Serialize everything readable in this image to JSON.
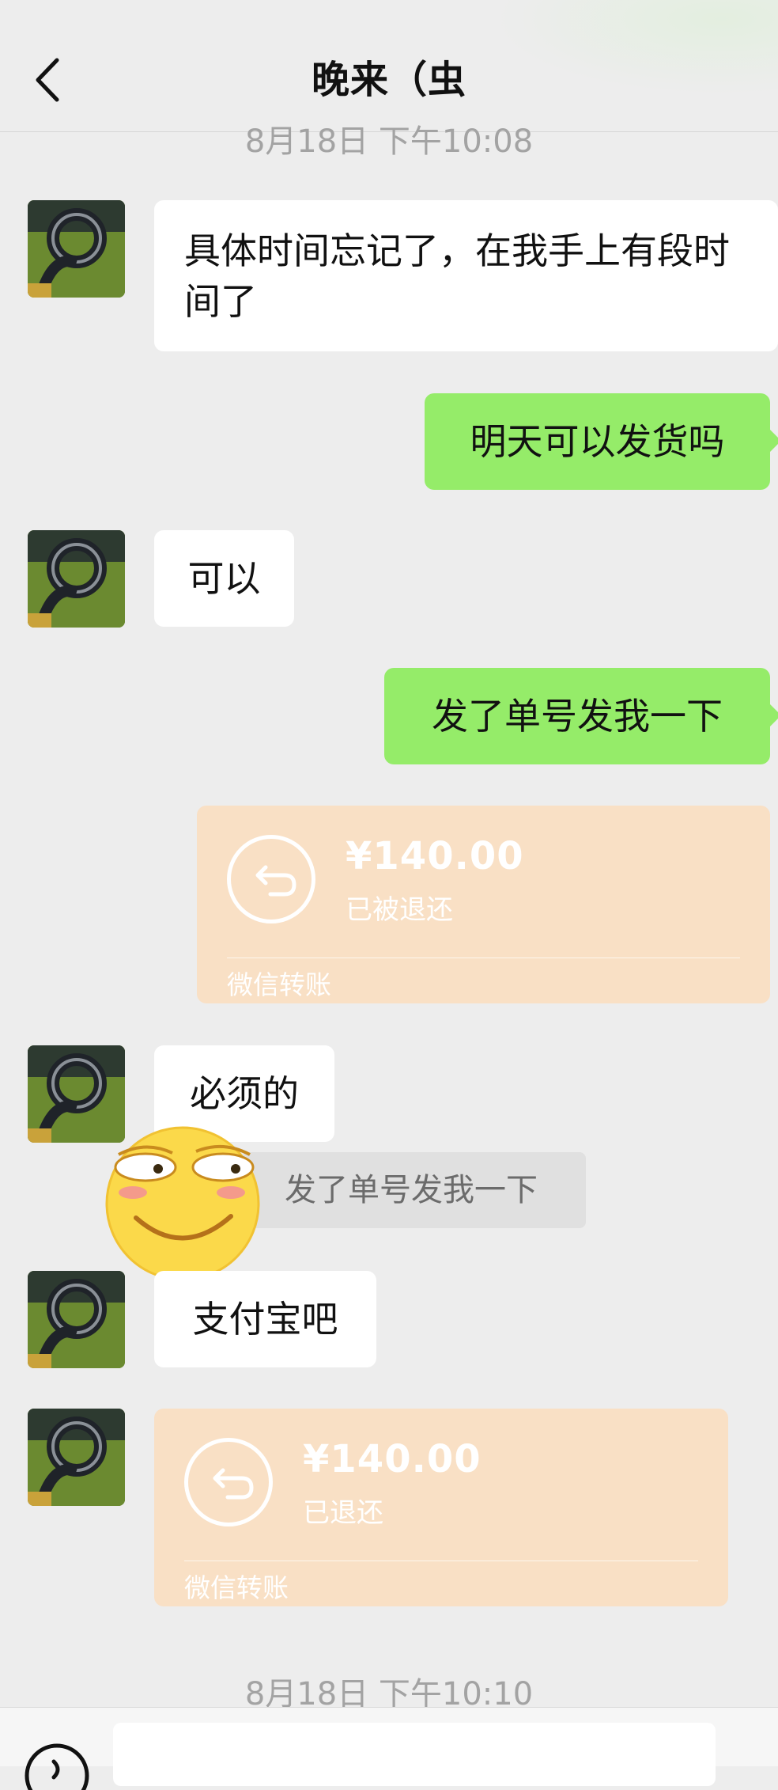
{
  "header": {
    "title": "晚来（虫"
  },
  "timestamps": {
    "top": "8月18日 下午10:08",
    "bottom": "8月18日 下午10:10"
  },
  "messages": {
    "m1": "具体时间忘记了，在我手上有段时间了",
    "m2": "明天可以发货吗",
    "m3": "可以",
    "m4": "发了单号发我一下",
    "m5": "必须的",
    "m6": "支付宝吧"
  },
  "transfer1": {
    "amount": "¥140.00",
    "status": "已被退还",
    "footer": "微信转账"
  },
  "transfer2": {
    "amount": "¥140.00",
    "status": "已退还",
    "footer": "微信转账"
  },
  "quote": {
    "text": "发了单号发我一下"
  },
  "colors": {
    "background": "#ededed",
    "outgoing_bubble": "#95ec69",
    "incoming_bubble": "#ffffff",
    "transfer_card": "#f9e0c5"
  }
}
